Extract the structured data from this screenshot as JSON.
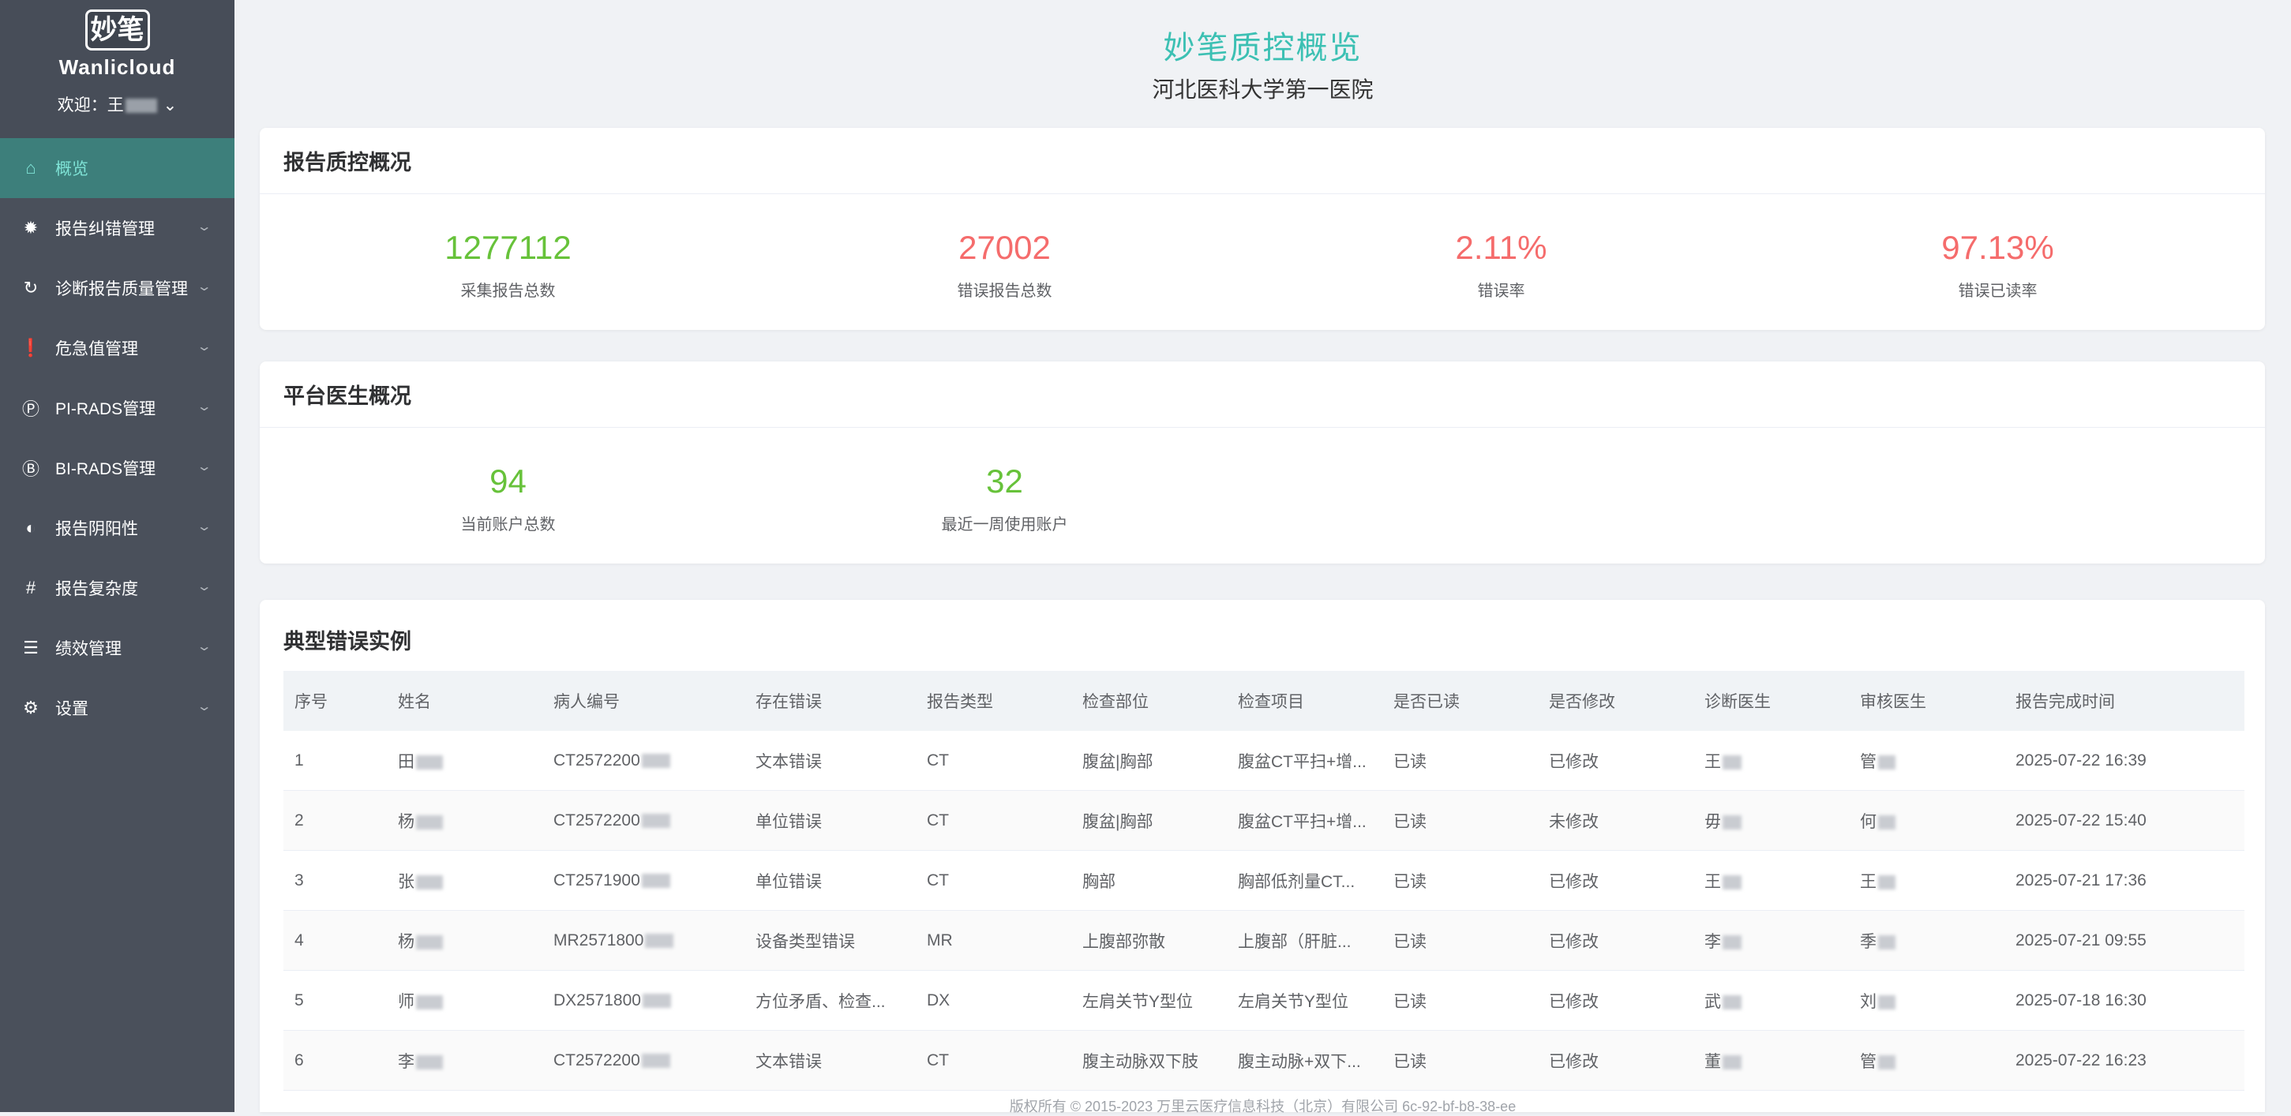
{
  "brand": {
    "logo_text": "妙笔",
    "name": "Wanlicloud",
    "welcome": "欢迎：王",
    "welcome_arrow": "⌄"
  },
  "menu": [
    {
      "label": "概览",
      "icon": "home-icon",
      "glyph": "⌂",
      "active": true
    },
    {
      "label": "报告纠错管理",
      "icon": "bug-icon",
      "glyph": "✹"
    },
    {
      "label": "诊断报告质量管理",
      "icon": "refresh-icon",
      "glyph": "↻"
    },
    {
      "label": "危急值管理",
      "icon": "alert-icon",
      "glyph": "❗"
    },
    {
      "label": "PI-RADS管理",
      "icon": "p-circle-icon",
      "glyph": "Ⓟ"
    },
    {
      "label": "BI-RADS管理",
      "icon": "b-circle-icon",
      "glyph": "Ⓑ"
    },
    {
      "label": "报告阴阳性",
      "icon": "contrast-icon",
      "glyph": "◐"
    },
    {
      "label": "报告复杂度",
      "icon": "grid-icon",
      "glyph": "#"
    },
    {
      "label": "绩效管理",
      "icon": "list-icon",
      "glyph": "☰"
    },
    {
      "label": "设置",
      "icon": "gear-icon",
      "glyph": "⚙"
    }
  ],
  "header": {
    "title": "妙笔质控概览",
    "hospital": "河北医科大学第一医院"
  },
  "report_qc": {
    "title": "报告质控概况",
    "stats": [
      {
        "value": "1277112",
        "label": "采集报告总数",
        "color": "#67c23a"
      },
      {
        "value": "27002",
        "label": "错误报告总数",
        "color": "#f56c6c"
      },
      {
        "value": "2.11%",
        "label": "错误率",
        "color": "#f56c6c"
      },
      {
        "value": "97.13%",
        "label": "错误已读率",
        "color": "#f56c6c"
      }
    ]
  },
  "doctors": {
    "title": "平台医生概况",
    "stats": [
      {
        "value": "94",
        "label": "当前账户总数",
        "color": "#67c23a"
      },
      {
        "value": "32",
        "label": "最近一周使用账户",
        "color": "#67c23a"
      }
    ]
  },
  "errors_table": {
    "title": "典型错误实例",
    "columns": [
      "序号",
      "姓名",
      "病人编号",
      "存在错误",
      "报告类型",
      "检查部位",
      "检查项目",
      "是否已读",
      "是否修改",
      "诊断医生",
      "审核医生",
      "报告完成时间"
    ],
    "rows": [
      [
        "1",
        "田",
        "CT2572200",
        "文本错误",
        "CT",
        "腹盆|胸部",
        "腹盆CT平扫+增...",
        "已读",
        "已修改",
        "王",
        "管",
        "2025-07-22 16:39"
      ],
      [
        "2",
        "杨",
        "CT2572200",
        "单位错误",
        "CT",
        "腹盆|胸部",
        "腹盆CT平扫+增...",
        "已读",
        "未修改",
        "毋",
        "何",
        "2025-07-22 15:40"
      ],
      [
        "3",
        "张",
        "CT2571900",
        "单位错误",
        "CT",
        "胸部",
        "胸部低剂量CT...",
        "已读",
        "已修改",
        "王",
        "王",
        "2025-07-21 17:36"
      ],
      [
        "4",
        "杨",
        "MR2571800",
        "设备类型错误",
        "MR",
        "上腹部弥散",
        "上腹部（肝脏...",
        "已读",
        "已修改",
        "李",
        "季",
        "2025-07-21 09:55"
      ],
      [
        "5",
        "师",
        "DX2571800",
        "方位矛盾、检查...",
        "DX",
        "左肩关节Y型位",
        "左肩关节Y型位",
        "已读",
        "已修改",
        "武",
        "刘",
        "2025-07-18 16:30"
      ],
      [
        "6",
        "李",
        "CT2572200",
        "文本错误",
        "CT",
        "腹主动脉双下肢",
        "腹主动脉+双下...",
        "已读",
        "已修改",
        "董",
        "管",
        "2025-07-22 16:23"
      ]
    ]
  },
  "footer": "版权所有 © 2015-2023 万里云医疗信息科技（北京）有限公司    6c-92-bf-b8-38-ee"
}
